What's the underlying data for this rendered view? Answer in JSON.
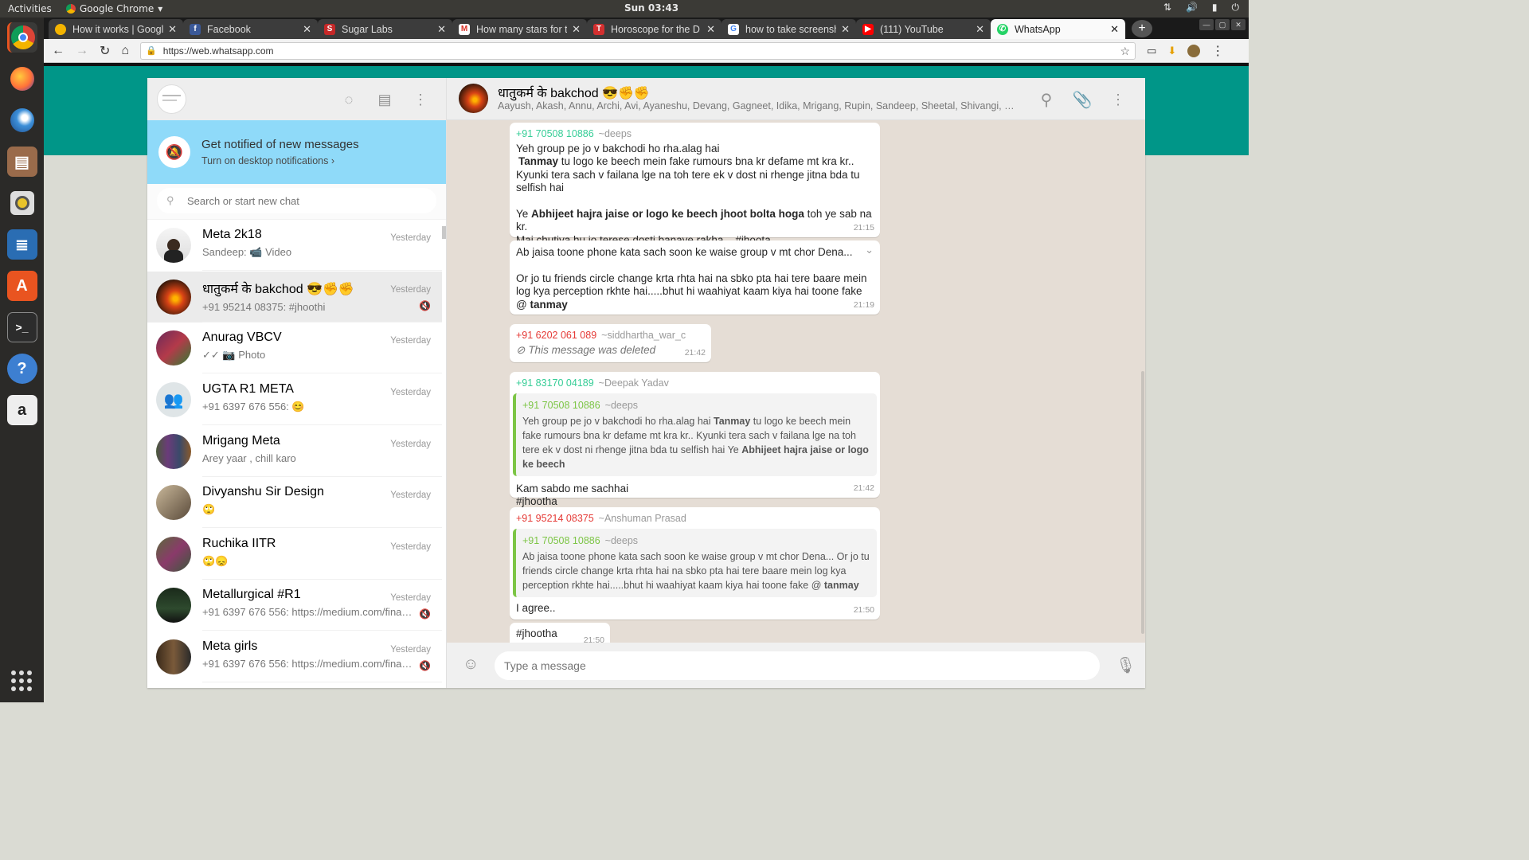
{
  "os": {
    "activities": "Activities",
    "app_name": "Google Chrome",
    "clock": "Sun 03:43"
  },
  "browser": {
    "tabs": [
      {
        "title": "How it works | Google"
      },
      {
        "title": "Facebook"
      },
      {
        "title": "Sugar Labs"
      },
      {
        "title": "How many stars for t"
      },
      {
        "title": "Horoscope for the D"
      },
      {
        "title": "how to take screensh"
      },
      {
        "title": "(111) YouTube"
      },
      {
        "title": "WhatsApp"
      }
    ],
    "url": "https://web.whatsapp.com"
  },
  "sidebar": {
    "notify_title": "Get notified of new messages",
    "notify_action": "Turn on desktop notifications ›",
    "search_placeholder": "Search or start new chat",
    "chats": [
      {
        "name": "Meta 2k18",
        "time": "Yesterday",
        "last": "Sandeep: 📹 Video"
      },
      {
        "name": "धातुकर्म के bakchod 😎✊✊",
        "time": "Yesterday",
        "last": "+91 95214 08375: #jhoothi"
      },
      {
        "name": "Anurag VBCV",
        "time": "Yesterday",
        "last": "✓✓ 📷 Photo"
      },
      {
        "name": "UGTA R1 META",
        "time": "Yesterday",
        "last": "+91 6397 676 556: 😊"
      },
      {
        "name": "Mrigang Meta",
        "time": "Yesterday",
        "last": "Arey yaar , chill karo"
      },
      {
        "name": "Divyanshu Sir Design",
        "time": "Yesterday",
        "last": "🙄"
      },
      {
        "name": "Ruchika IITR",
        "time": "Yesterday",
        "last": "🙄😞"
      },
      {
        "name": "Metallurgical #R1",
        "time": "Yesterday",
        "last": "+91 6397 676 556: https://medium.com/financ…"
      },
      {
        "name": "Meta girls",
        "time": "Yesterday",
        "last": "+91 6397 676 556: https://medium.com/financ…"
      }
    ]
  },
  "conversation": {
    "title": "धातुकर्म के bakchod 😎✊✊",
    "members": "Aayush, Akash, Annu, Archi, Avi, Ayaneshu, Devang, Gagneet, Idika, Mrigang, Rupin, Sandeep, Sheetal, Shivangi, Shreyan…",
    "messages": {
      "m1": {
        "phone": "+91 70508 10886",
        "author": "~deeps",
        "line1": "Yeh group pe jo v bakchodi ho rha.alag hai",
        "bold1": "Tanmay",
        "line2": " tu logo ke beech mein fake rumours bna kr defame mt kra kr..",
        "line3": "Kyunki tera sach v failana lge na toh tere ek v dost ni rhenge jitna bda tu selfish hai",
        "line4a": "Ye ",
        "bold2": "Abhijeet hajra jaise or logo ke beech jhoot bolta hoga",
        "line4b": " toh ye sab na kr.",
        "line5": "Mai chutiya hu jo terese dosti banaye rakha....#jhoota",
        "time": "21:15"
      },
      "m2": {
        "line1": "Ab jaisa toone phone kata sach soon ke waise group v mt chor Dena...",
        "line2": "Or jo tu friends circle change krta rhta hai na sbko pta hai tere baare mein log kya perception rkhte hai.....bhut hi waahiyat kaam kiya hai toone fake @",
        "bold": "tanmay",
        "time": "21:19"
      },
      "m3": {
        "phone": "+91 6202 061 089",
        "author": "~siddhartha_war_c",
        "text": "This message was deleted",
        "time": "21:42"
      },
      "m4": {
        "phone": "+91 83170 04189",
        "author": "~Deepak Yadav",
        "q_phone": "+91 70508 10886",
        "q_author": "~deeps",
        "q_a": "Yeh group pe jo v bakchodi ho rha.alag hai ",
        "q_b1": "Tanmay",
        "q_c": " tu logo ke beech mein fake rumours bna kr defame mt kra kr.. Kyunki tera sach v failana lge na toh tere ek v dost ni rhenge jitna bda tu selfish hai Ye ",
        "q_b2": "Abhijeet hajra jaise or logo ke beech",
        "line1": "Kam sabdo me sachhai",
        "line2": "#jhootha",
        "time": "21:42"
      },
      "m5": {
        "phone": "+91 95214 08375",
        "author": "~Anshuman Prasad",
        "q_phone": "+91 70508 10886",
        "q_author": "~deeps",
        "q_a": "Ab jaisa toone phone kata sach soon ke waise group v mt chor Dena... Or jo tu friends circle change krta rhta hai na sbko pta hai tere baare mein log kya perception rkhte hai.....bhut hi waahiyat kaam kiya hai toone fake @ ",
        "q_b": "tanmay",
        "text": "I agree..",
        "time": "21:50"
      },
      "m6": {
        "text": "#jhootha",
        "time": "21:50"
      }
    },
    "input_placeholder": "Type a message"
  },
  "colors": {
    "brand_teal": "#009688",
    "notify_blue": "#8fdaf9",
    "chat_bg": "#e5ddd5",
    "phone_green": "#35cd96",
    "phone_red": "#e53935",
    "quote_green": "#7cc545"
  }
}
